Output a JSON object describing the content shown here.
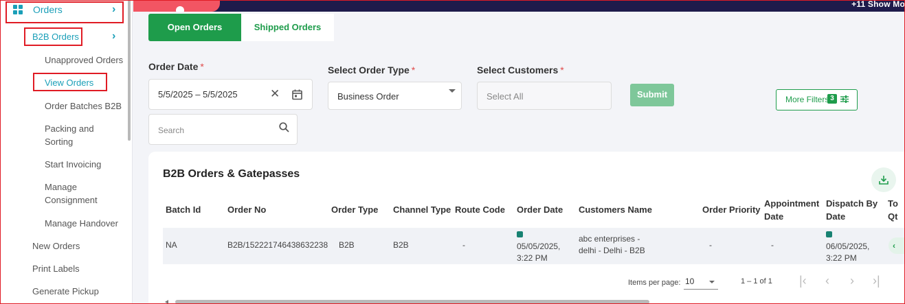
{
  "sidebar": {
    "orders_label": "Orders",
    "b2b_orders_label": "B2B Orders",
    "items": [
      "Unapproved Orders",
      "View Orders",
      "Order Batches B2B",
      "Packing and",
      "Sorting",
      "Start Invoicing",
      "Manage",
      "Consignment",
      "Manage Handover",
      "New Orders",
      "Print Labels",
      "Generate Pickup"
    ]
  },
  "topbar": {
    "more_label": "+11 Show Mo"
  },
  "tabs": {
    "open": "Open Orders",
    "shipped": "Shipped Orders"
  },
  "filters": {
    "order_date_label": "Order Date",
    "order_date_value": "5/5/2025 – 5/5/2025",
    "order_type_label": "Select Order Type",
    "order_type_value": "Business Order",
    "customers_label": "Select Customers",
    "customers_value": "Select All",
    "submit_label": "Submit",
    "more_filters_label": "More Filters",
    "more_filters_count": "3",
    "search_placeholder": "Search",
    "required_mark": "*"
  },
  "card": {
    "title": "B2B Orders & Gatepasses",
    "headers": {
      "batch_id": "Batch Id",
      "order_no": "Order No",
      "order_type": "Order Type",
      "channel_type": "Channel Type",
      "route_code": "Route Code",
      "order_date": "Order Date",
      "customers_name": "Customers Name",
      "order_priority": "Order Priority",
      "appointment_1": "Appointment",
      "appointment_2": "Date",
      "dispatch_1": "Dispatch By",
      "dispatch_2": "Date",
      "to_1": "To",
      "to_2": "Qt"
    },
    "row": {
      "batch_id": "NA",
      "order_no": "B2B/152221746438632238",
      "order_type": "B2B",
      "channel_type": "B2B",
      "route_code": "-",
      "order_date_1": "05/05/2025,",
      "order_date_2": "3:22 PM",
      "customer_1": "abc enterprises -",
      "customer_2": "delhi - Delhi - B2B",
      "order_priority": "-",
      "appointment": "-",
      "dispatch_1": "06/05/2025,",
      "dispatch_2": "3:22 PM"
    },
    "pagination": {
      "items_per_page_label": "Items per page:",
      "items_per_page_value": "10",
      "range": "1 – 1 of 1"
    }
  },
  "colors": {
    "accent": "#1e9c4b",
    "sidebar_accent": "#1a9fb8",
    "highlight": "#e01b24",
    "topbar": "#1e1b4b"
  }
}
